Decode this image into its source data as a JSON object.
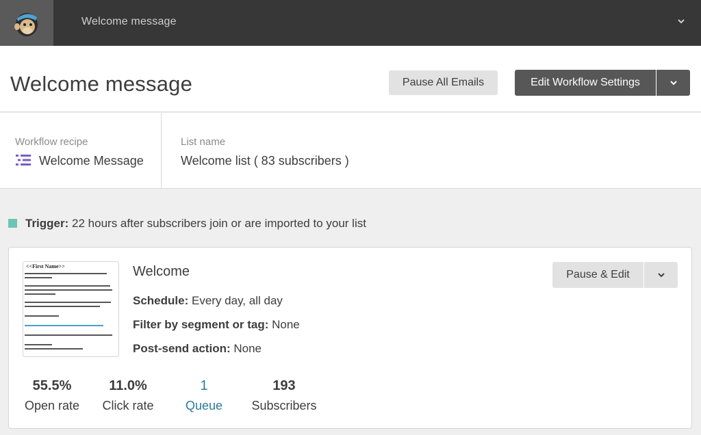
{
  "topbar": {
    "title": "Welcome message"
  },
  "header": {
    "title": "Welcome message",
    "pause_all_label": "Pause All Emails",
    "edit_settings_label": "Edit Workflow Settings"
  },
  "info": {
    "recipe_label": "Workflow recipe",
    "recipe_value": "Welcome Message",
    "list_label": "List name",
    "list_value": "Welcome list ( 83 subscribers )"
  },
  "trigger": {
    "label": "Trigger:",
    "text": "22 hours after subscribers join or are imported to your list",
    "color": "#6dc5b5"
  },
  "email": {
    "title": "Welcome",
    "thumbnail_heading": "<<First Name>>",
    "schedule_label": "Schedule:",
    "schedule_value": "Every day, all day",
    "filter_label": "Filter by segment or tag:",
    "filter_value": "None",
    "postsend_label": "Post-send action:",
    "postsend_value": "None",
    "pause_edit_label": "Pause & Edit",
    "stats": [
      {
        "value": "55.5%",
        "label": "Open rate"
      },
      {
        "value": "11.0%",
        "label": "Click rate"
      },
      {
        "value": "1",
        "label": "Queue"
      },
      {
        "value": "193",
        "label": "Subscribers"
      }
    ]
  },
  "colors": {
    "topbar": "#373737",
    "dark_button": "#575757",
    "link": "#2b7a9a",
    "accent_purple": "#7b5cc6"
  }
}
